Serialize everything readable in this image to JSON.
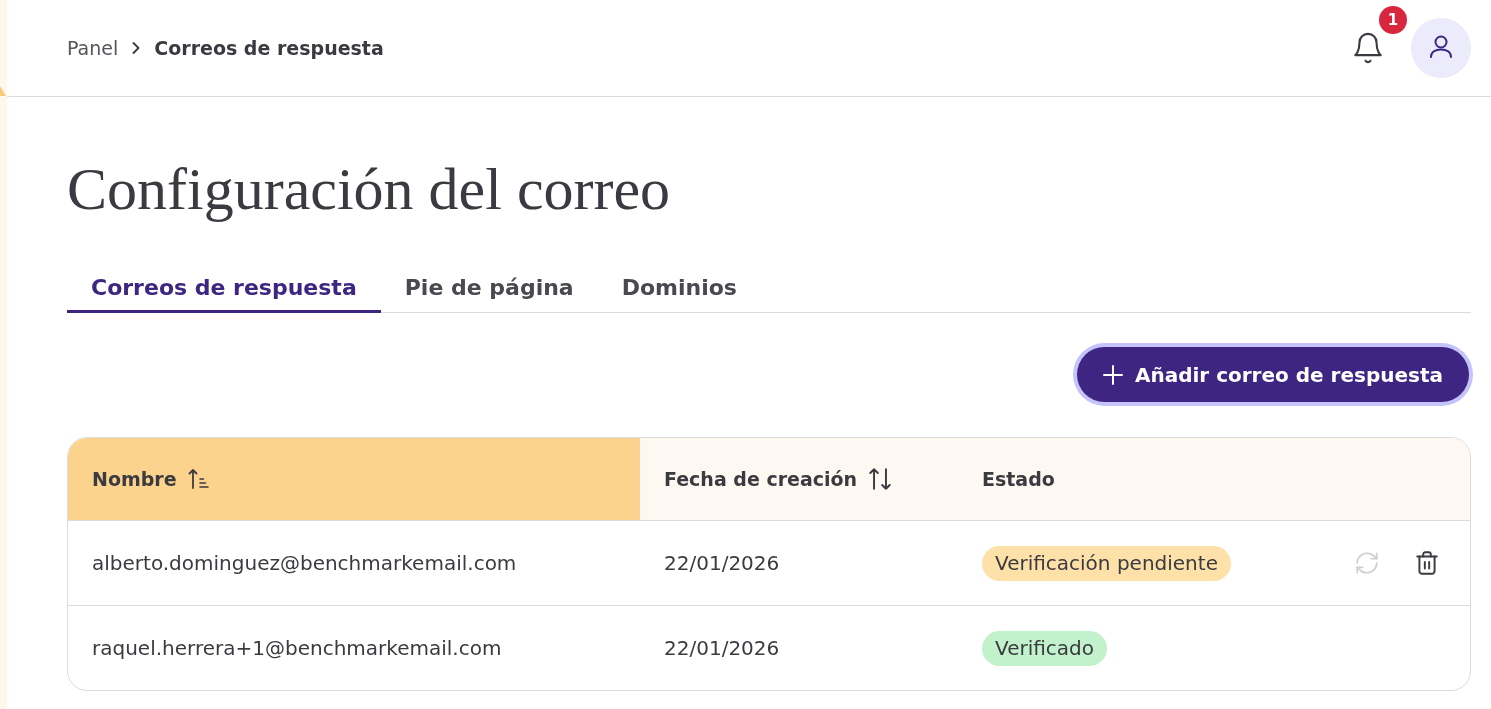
{
  "breadcrumb": [
    {
      "label": "Panel",
      "current": false
    },
    {
      "label": "Correos de respuesta",
      "current": true
    }
  ],
  "notifications": {
    "count": "1"
  },
  "title": "Configuración del correo",
  "tabs": [
    {
      "label": "Correos de respuesta",
      "selected": true
    },
    {
      "label": "Pie de página",
      "selected": false
    },
    {
      "label": "Dominios",
      "selected": false
    }
  ],
  "add_button": {
    "label": "Añadir correo de respuesta"
  },
  "table": {
    "columns": [
      {
        "label": "Nombre",
        "kind": "ascending",
        "selected": true
      },
      {
        "label": "Fecha de creación",
        "kind": "sortable",
        "selected": false
      },
      {
        "label": "Estado",
        "kind": "plain",
        "selected": false
      }
    ],
    "rows": [
      {
        "name": "alberto.dominguez@benchmarkemail.com",
        "created": "22/01/2026",
        "status": {
          "label": "Verificación pendiente",
          "color": "#fde1a8"
        },
        "actions": [
          {
            "kind": "resend",
            "disabled": true
          },
          {
            "kind": "delete",
            "disabled": false
          }
        ]
      },
      {
        "name": "raquel.herrera+1@benchmarkemail.com",
        "created": "22/01/2026",
        "status": {
          "label": "Verificado",
          "color": "#c2f2cc"
        }
      }
    ]
  }
}
